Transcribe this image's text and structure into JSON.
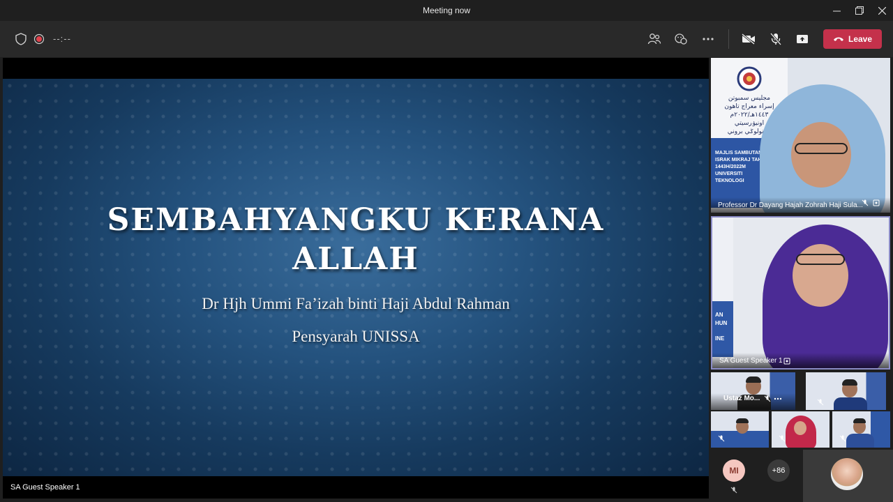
{
  "window": {
    "title": "Meeting now"
  },
  "toolbar": {
    "timer": "--:--",
    "leave_label": "Leave",
    "icons": [
      "shield-icon",
      "record-icon",
      "people-icon",
      "chat-reactions-icon",
      "more-icon",
      "camera-off-icon",
      "mic-off-icon",
      "share-icon",
      "phone-icon"
    ],
    "colors": {
      "leave": "#c4314b",
      "record": "#e2414c"
    }
  },
  "stage": {
    "label": "SA Guest Speaker 1",
    "slide": {
      "title_line1": "SEMBAHYANGKU KERANA",
      "title_line2": "ALLAH",
      "subtitle": "Dr Hjh Ummi Fa’izah binti Haji Abdul Rahman",
      "role": "Pensyarah UNISSA"
    }
  },
  "participants": {
    "tile1": {
      "name": "Professor Dr Dayang Hajah Zohrah Haji Sula...",
      "banner_arabic": [
        "مجليس سمبوتن",
        "إسراء معراج تاهون",
        "١٤٤٣هـ/٢٠٢٢م",
        "اونيۏرسيتي",
        "تيكنولوݢي بروني"
      ],
      "banner_latin": [
        "MAJLIS SAMBUTAN",
        "ISRAK MIKRAJ TAHUN",
        "1443H/2022M",
        "UNIVERSITI",
        "TEKNOLOGI"
      ]
    },
    "tile2": {
      "name": "SA Guest Speaker 1",
      "banner_fragments": [
        "AN",
        "HUN",
        "INE"
      ]
    },
    "tile3": {
      "name": "Ustaz Mo..."
    },
    "bottom": {
      "avatar_initials": "MI",
      "more_count": "+86"
    }
  }
}
